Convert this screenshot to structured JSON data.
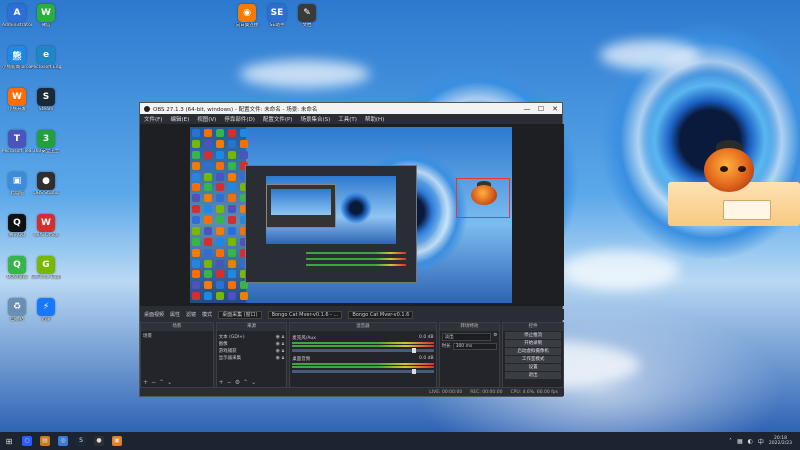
{
  "desktop_icons": [
    {
      "label": "Administrator",
      "color": "#2d6fd6",
      "glyph": "A"
    },
    {
      "label": "小熊新闻 broadcast",
      "color": "#1e88e5",
      "glyph": "熊"
    },
    {
      "label": "小熊开发",
      "color": "#ff6d00",
      "glyph": "W"
    },
    {
      "label": "Microsoft Teams",
      "color": "#4b53bc",
      "glyph": "T"
    },
    {
      "label": "此电脑",
      "color": "#3d8bd9",
      "glyph": "▣"
    },
    {
      "label": "腾讯QQ",
      "color": "#111111",
      "glyph": "Q"
    },
    {
      "label": "QQ浏览器",
      "color": "#37b44a",
      "glyph": "Q"
    },
    {
      "label": "回收站",
      "color": "#6a8fb5",
      "glyph": "♻"
    },
    {
      "label": "微信",
      "color": "#2bae3e",
      "glyph": "W"
    },
    {
      "label": "Microsoft Edge",
      "color": "#1e88c7",
      "glyph": "e"
    },
    {
      "label": "Steam",
      "color": "#1b2838",
      "glyph": "S"
    },
    {
      "label": "360安全卫士",
      "color": "#22a03a",
      "glyph": "3"
    },
    {
      "label": "OBS Studio",
      "color": "#302e31",
      "glyph": "●"
    },
    {
      "label": "WPS Office",
      "color": "#d32f2f",
      "glyph": "W"
    },
    {
      "label": "GeForce Experience",
      "color": "#76b900",
      "glyph": "G"
    },
    {
      "label": "迅雷",
      "color": "#1677ff",
      "glyph": "⚡"
    }
  ],
  "top_icons": [
    {
      "label": "向日葵连接",
      "color": "#f57c00",
      "glyph": "◉"
    },
    {
      "label": "SE助手",
      "color": "#2c6fd1",
      "glyph": "SE"
    },
    {
      "label": "文档",
      "color": "#3a3a3a",
      "glyph": "✎"
    }
  ],
  "obs": {
    "title": "OBS 27.1.3 (64-bit, windows) - 配置文件: 未命名 - 场景: 未命名",
    "menu": [
      "文件(F)",
      "编辑(E)",
      "视图(V)",
      "停靠部件(D)",
      "配置文件(P)",
      "场景集合(S)",
      "工具(T)",
      "帮助(H)"
    ],
    "scene_bar": {
      "scene_label": "桌面视频",
      "props_label": "属性",
      "filters_label": "滤镜",
      "mode_label": "模式",
      "source_select": "桌面采集 (窗口)",
      "window_select": "Bongo Cat Mver-v0.1.6 - ...",
      "window_select2": "Bongo Cat Mver-v0.1.6"
    },
    "docks": {
      "scenes": {
        "title": "场景",
        "items": [
          "场景"
        ]
      },
      "sources": {
        "title": "来源",
        "items": [
          "文本 (GDI+)",
          "图像",
          "游戏捕获",
          "显示器采集"
        ]
      },
      "mixer": {
        "title": "混音器",
        "rows": [
          {
            "name": "麦克风/Aux",
            "db": "0.0 dB"
          },
          {
            "name": "桌面音频",
            "db": "0.0 dB"
          }
        ]
      },
      "transitions": {
        "title": "转场特效",
        "type": "淡出",
        "duration_label": "时长",
        "duration": "300 ms"
      },
      "controls": {
        "title": "控件",
        "buttons": [
          "停止推流",
          "开始录制",
          "启动虚拟摄像机",
          "工作室模式",
          "设置",
          "退出"
        ]
      }
    },
    "status": {
      "live": "LIVE: 00:00:00",
      "rec": "REC: 00:00:00",
      "cpu": "CPU: 4.6%, 60.00 fps"
    }
  },
  "taskbar": {
    "start_glyph": "⊞",
    "items": [
      {
        "color": "#2b5cff",
        "glyph": "○"
      },
      {
        "color": "#c97c1b",
        "glyph": "▤"
      },
      {
        "color": "#3a7bd5",
        "glyph": "◎"
      },
      {
        "color": "#1b2838",
        "glyph": "S"
      },
      {
        "color": "#302e31",
        "glyph": "●"
      },
      {
        "color": "#e67e22",
        "glyph": "▣"
      }
    ],
    "time": "20:18",
    "date": "2022/2/23"
  }
}
